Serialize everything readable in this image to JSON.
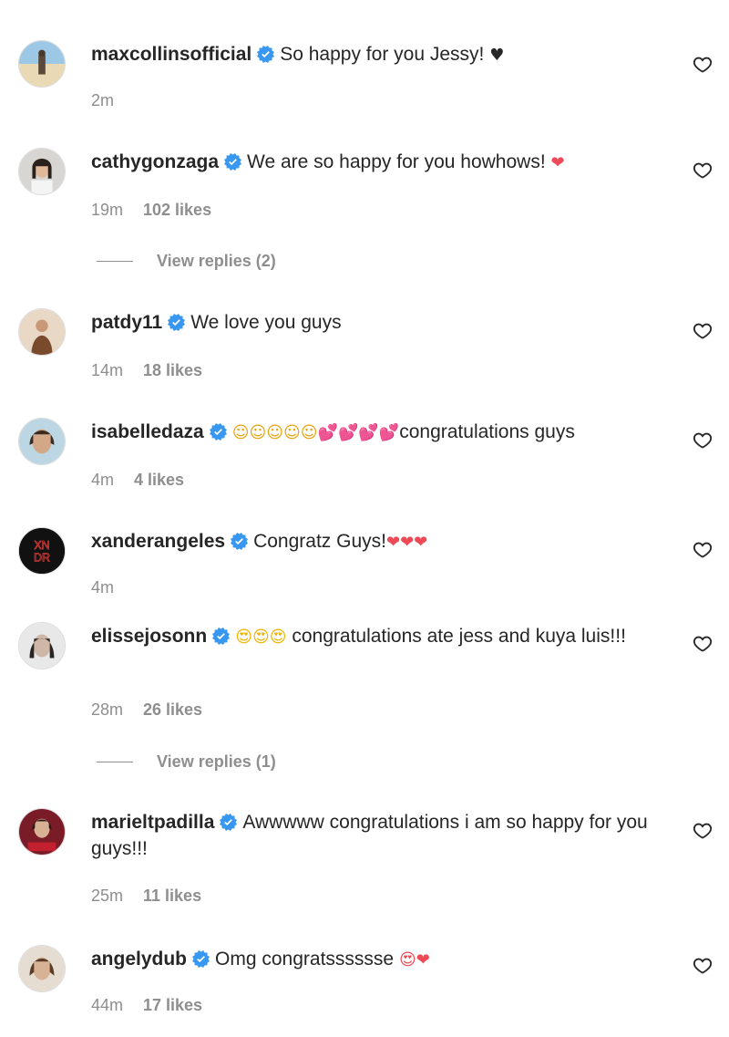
{
  "comments": [
    {
      "username": "maxcollinsofficial",
      "text": "So happy for you Jessy!",
      "emoji_after": "♥",
      "time": "2m",
      "likes": ""
    },
    {
      "username": "cathygonzaga",
      "text": "We are so happy for you howhows!",
      "emoji_after": "❤",
      "time": "19m",
      "likes": "102 likes",
      "replies": "View replies (2)"
    },
    {
      "username": "patdy11",
      "text": "We love you guys",
      "emoji_after": "",
      "time": "14m",
      "likes": "18 likes"
    },
    {
      "username": "isabelledaza",
      "emoji_before": "☺☺☺☺☺💕💕💕💕",
      "text": "congratulations guys",
      "time": "4m",
      "likes": "4 likes"
    },
    {
      "username": "xanderangeles",
      "text": "Congratz Guys!",
      "emoji_after": "❤❤❤",
      "time": "4m",
      "likes": ""
    },
    {
      "username": "elissejosonn",
      "emoji_before": "😍😍😍",
      "text": "congratulations ate jess and kuya luis!!!",
      "time": "28m",
      "likes": "26 likes",
      "replies": "View replies (1)"
    },
    {
      "username": "marieltpadilla",
      "text": "Awwwww congratulations i am so happy for you guys!!!",
      "time": "25m",
      "likes": "11 likes"
    },
    {
      "username": "angelydub",
      "text": "Omg congratsssssse",
      "emoji_after": "😍❤",
      "time": "44m",
      "likes": "17 likes"
    }
  ],
  "avatar_initials": {
    "xander": "XN DR"
  },
  "colors": {
    "verified": "#3897f0",
    "meta": "#8e8e8e",
    "text": "#262626",
    "heart_red": "#ed4956"
  }
}
